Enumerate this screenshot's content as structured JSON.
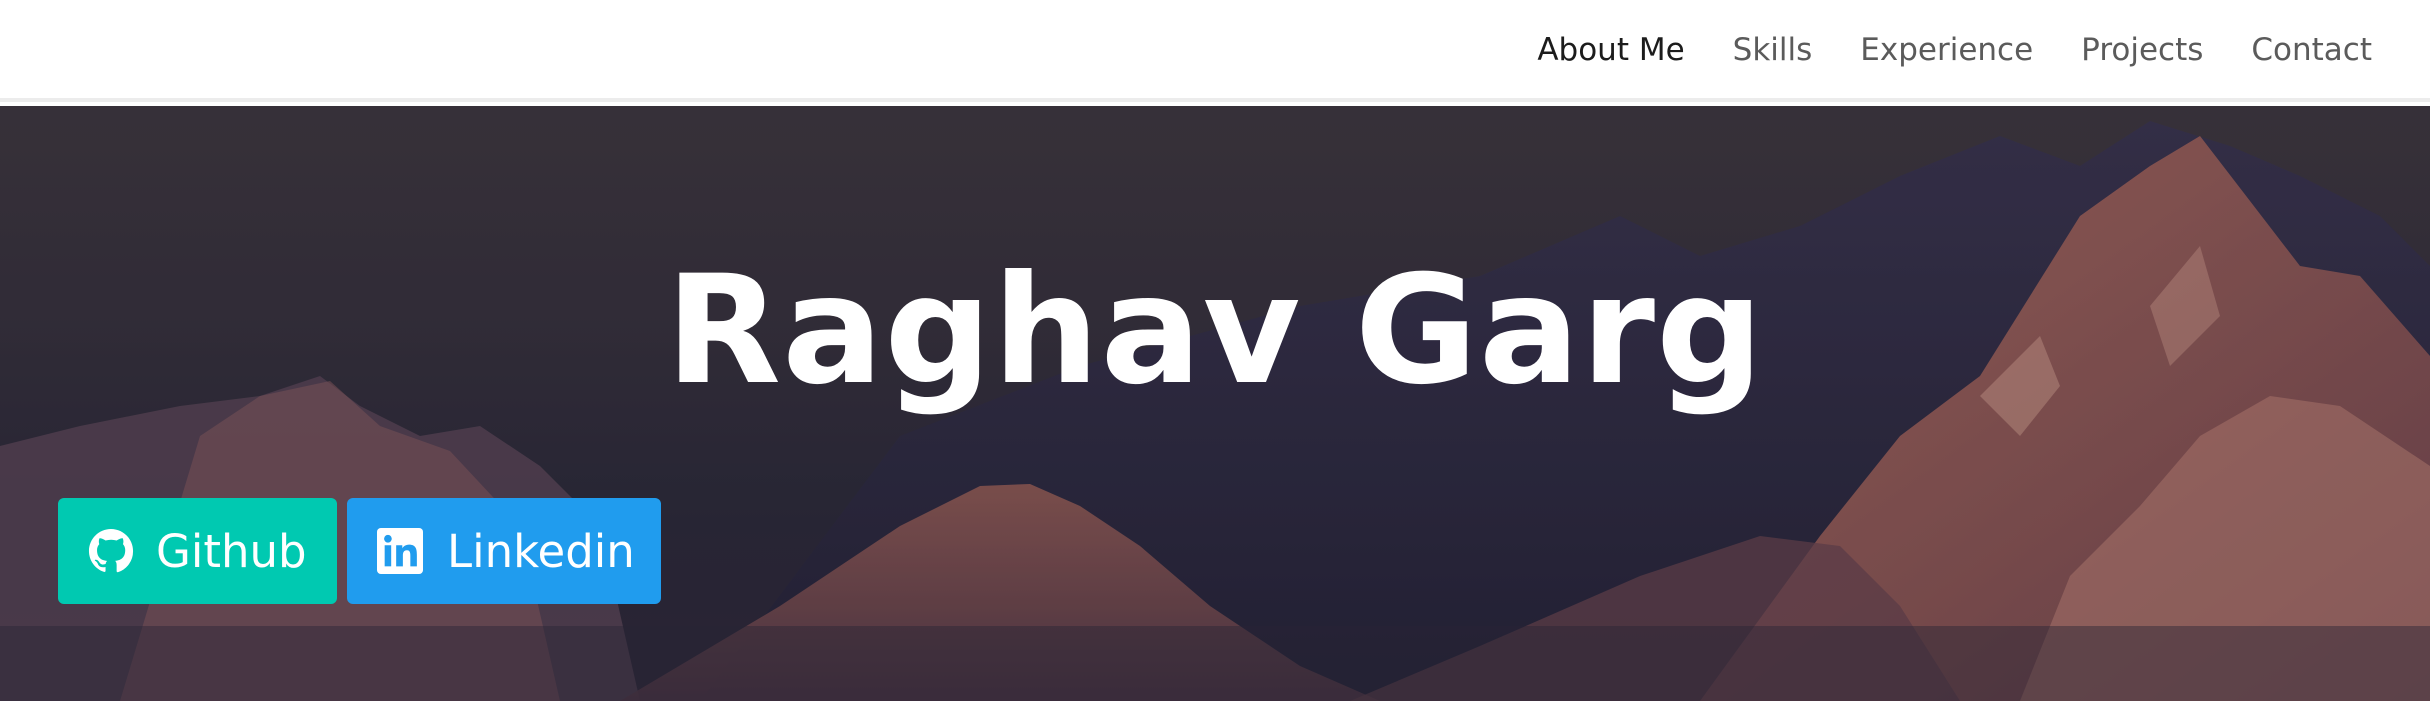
{
  "nav": {
    "items": [
      {
        "label": "About Me",
        "active": true
      },
      {
        "label": "Skills",
        "active": false
      },
      {
        "label": "Experience",
        "active": false
      },
      {
        "label": "Projects",
        "active": false
      },
      {
        "label": "Contact",
        "active": false
      }
    ]
  },
  "hero": {
    "title": "Raghav Garg",
    "buttons": {
      "github": {
        "label": "Github",
        "icon": "github-icon",
        "color": "#00c9b1"
      },
      "linkedin": {
        "label": "Linkedin",
        "icon": "linkedin-icon",
        "color": "#209cee"
      }
    }
  }
}
